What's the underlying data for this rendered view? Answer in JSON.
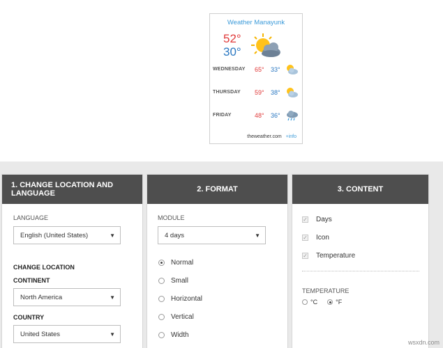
{
  "widget": {
    "title": "Weather Manayunk",
    "current_hi": "52°",
    "current_lo": "30°",
    "days": [
      {
        "day": "WEDNESDAY",
        "hi": "65°",
        "lo": "33°",
        "icon": "partly-cloudy-icon"
      },
      {
        "day": "THURSDAY",
        "hi": "59°",
        "lo": "38°",
        "icon": "partly-cloudy-icon"
      },
      {
        "day": "FRIDAY",
        "hi": "48°",
        "lo": "36°",
        "icon": "rain-cloud-icon"
      }
    ],
    "footer_brand": "theweather.com",
    "footer_link": "+info",
    "current_icon": "sun-cloud-icon"
  },
  "panels": {
    "location": {
      "title": "1. CHANGE LOCATION AND LANGUAGE",
      "language_label": "LANGUAGE",
      "language_value": "English (United States)",
      "change_location_label": "CHANGE LOCATION",
      "continent_label": "CONTINENT",
      "continent_value": "North America",
      "country_label": "COUNTRY",
      "country_value": "United States"
    },
    "format": {
      "title": "2. FORMAT",
      "module_label": "MODULE",
      "module_value": "4 days",
      "options": [
        "Normal",
        "Small",
        "Horizontal",
        "Vertical",
        "Width"
      ],
      "selected": "Normal"
    },
    "content": {
      "title": "3. CONTENT",
      "checks": [
        "Days",
        "Icon",
        "Temperature"
      ],
      "temperature_label": "TEMPERATURE",
      "unit_c": "°C",
      "unit_f": "°F",
      "selected_unit": "°F"
    }
  },
  "colors": {
    "header_bg": "#4e4e4e",
    "accent_blue": "#3a9ad9",
    "hi_red": "#e03a3a",
    "lo_blue": "#2b78c2",
    "config_bg": "#e9e9e9"
  },
  "watermark": "wsxdn.com"
}
